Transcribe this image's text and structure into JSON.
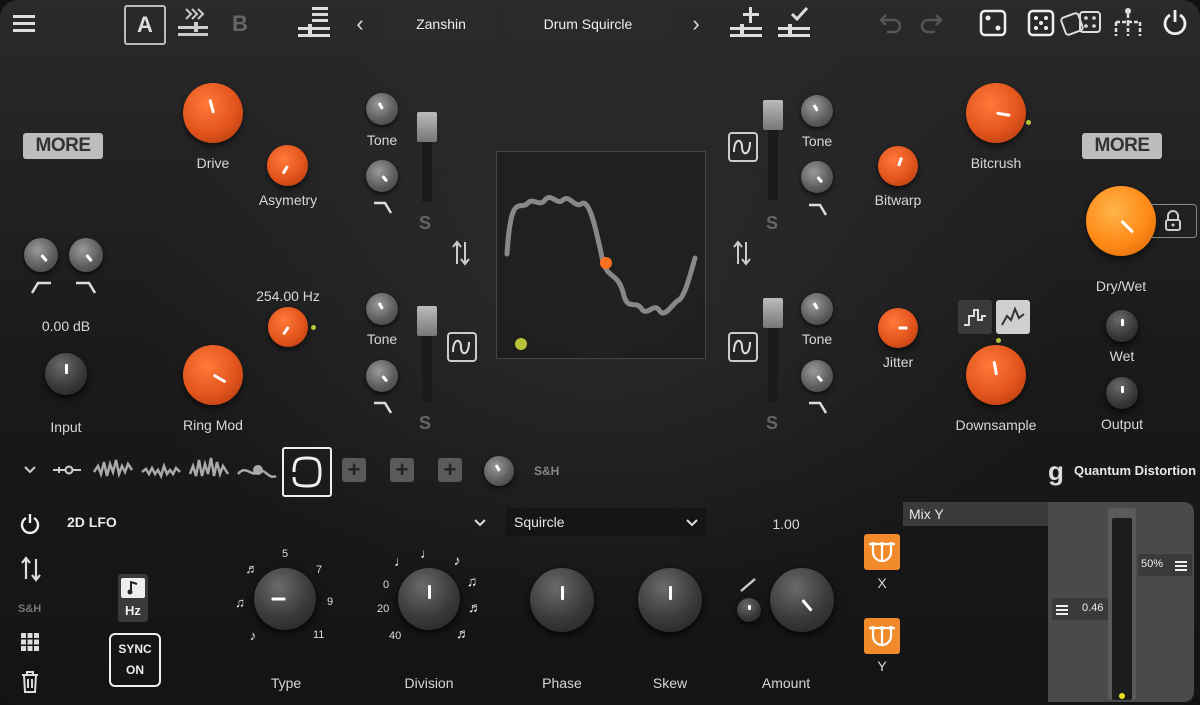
{
  "header": {
    "ab_a": "A",
    "ab_b": "B",
    "preset_left": "Zanshin",
    "preset_right": "Drum Squircle",
    "nav_prev": "‹",
    "nav_next": "›"
  },
  "left_panel": {
    "more_label": "MORE",
    "gain_value": "0.00 dB",
    "input_label": "Input"
  },
  "distortion": {
    "drive_label": "Drive",
    "asymmetry_label": "Asymetry",
    "ringmod_freq": "254.00 Hz",
    "ringmod_label": "Ring Mod",
    "tone_label_1": "Tone",
    "tone_label_2": "Tone",
    "tone_label_3": "Tone",
    "tone_label_4": "Tone",
    "s_label": "S"
  },
  "right_panel": {
    "bitcrush_label": "Bitcrush",
    "bitwarp_label": "Bitwarp",
    "jitter_label": "Jitter",
    "downsample_label": "Downsample",
    "more_label": "MORE",
    "drywet_label": "Dry/Wet",
    "wet_label": "Wet",
    "output_label": "Output"
  },
  "mod_strip": {
    "sh_label": "S&H"
  },
  "brand": {
    "logo_letter": "g",
    "product_name": "Quantum Distortion"
  },
  "lfo": {
    "type_dropdown": "2D LFO",
    "shape_dropdown": "Squircle",
    "amount_value": "1.00",
    "hz_label": "Hz",
    "sync_label_1": "SYNC",
    "sync_label_2": "ON",
    "sh_label": "S&H",
    "knob_labels": [
      "Type",
      "Division",
      "Phase",
      "Skew",
      "Amount"
    ],
    "type_marks": [
      "5",
      "7",
      "9",
      "11"
    ],
    "division_marks": [
      "0",
      "20",
      "40"
    ],
    "x_label": "X",
    "y_label": "Y",
    "mix_label": "Mix Y",
    "mix_percent": "50%",
    "mix_value": "0.46"
  },
  "colors": {
    "accent_orange": "#e2541c",
    "bright_orange": "#ff8a16",
    "lime_dot": "#b8c43a"
  }
}
